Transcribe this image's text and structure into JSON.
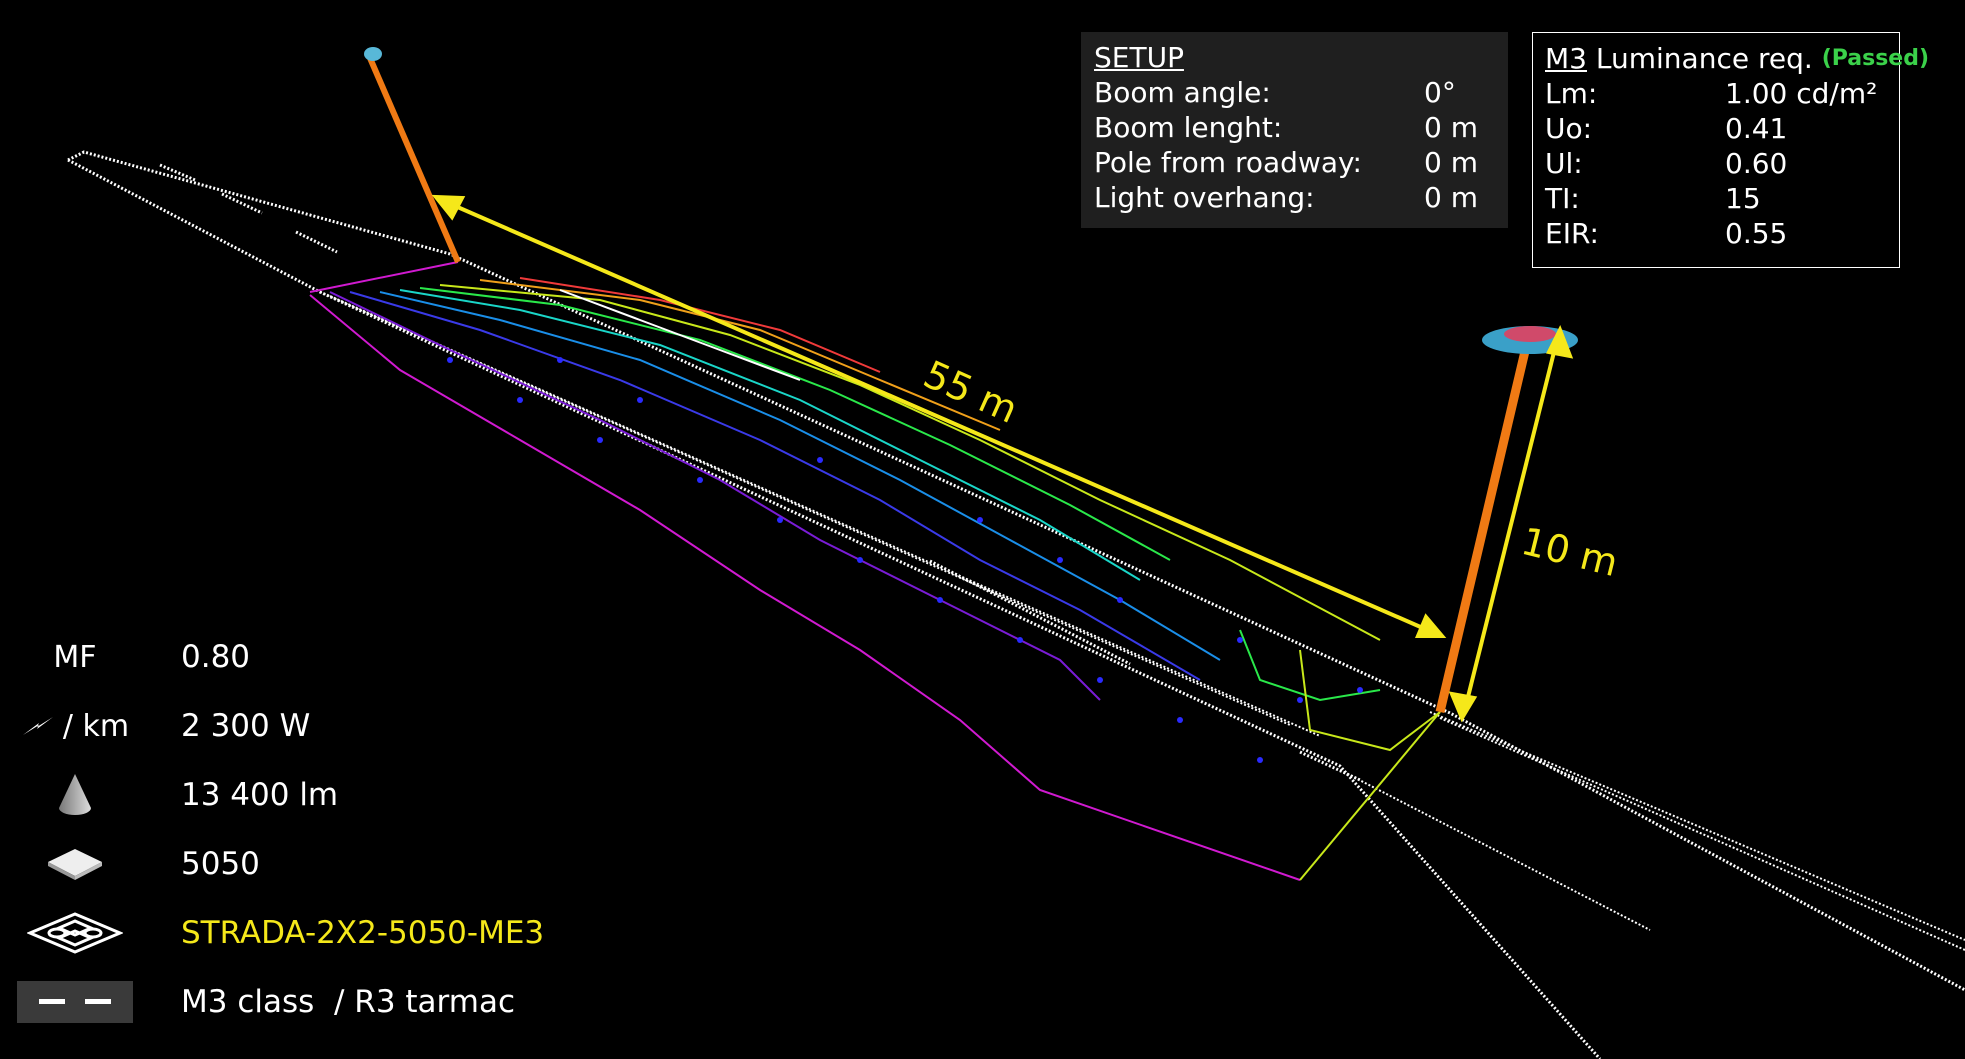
{
  "colors": {
    "background": "#000000",
    "pole": "#f07a14",
    "dimension": "#f5e81a",
    "road_lines": "#ffffff",
    "passed": "#3bd14a",
    "product_name": "#f5e81a"
  },
  "dimensions": {
    "pole_spacing": "55 m",
    "pole_height": "10 m"
  },
  "setup": {
    "title": "SETUP",
    "rows": [
      {
        "label": "Boom angle:",
        "value": "0°"
      },
      {
        "label": "Boom lenght:",
        "value": "0 m"
      },
      {
        "label": "Pole from roadway:",
        "value": "0 m"
      },
      {
        "label": "Light overhang:",
        "value": "0 m"
      }
    ]
  },
  "luminance": {
    "class": "M3",
    "title": "Luminance req.",
    "status": "(Passed)",
    "rows": [
      {
        "label": "Lm:",
        "value": "1.00 cd/m²"
      },
      {
        "label": "Uo:",
        "value": "0.41"
      },
      {
        "label": "Ul:",
        "value": "0.60"
      },
      {
        "label": "TI:",
        "value": "15"
      },
      {
        "label": "EIR:",
        "value": "0.55"
      }
    ]
  },
  "legend": [
    {
      "symbol": "MF",
      "icon": "none",
      "value": "0.80"
    },
    {
      "symbol": "/ km",
      "icon": "lightning-icon",
      "value": "2 300 W"
    },
    {
      "symbol": "",
      "icon": "light-cone-icon",
      "value": "13 400 lm"
    },
    {
      "symbol": "",
      "icon": "led-chip-icon",
      "value": "5050"
    },
    {
      "symbol": "",
      "icon": "luminaire-module-icon",
      "value": "STRADA-2X2-5050-ME3"
    },
    {
      "symbol": "",
      "icon": "road-marking-icon",
      "value": "M3 class  / R3 tarmac"
    }
  ]
}
